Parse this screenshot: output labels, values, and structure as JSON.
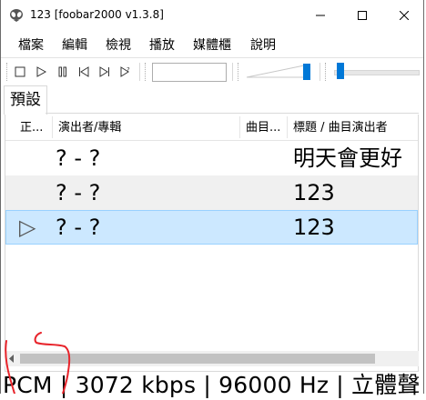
{
  "window": {
    "title": "123  [foobar2000 v1.3.8]",
    "icon": "alien-icon"
  },
  "window_controls": {
    "minimize": "minimize-icon",
    "maximize": "maximize-icon",
    "close": "close-icon"
  },
  "menu": {
    "items": [
      "檔案",
      "編輯",
      "檢視",
      "播放",
      "媒體櫃",
      "說明"
    ]
  },
  "toolbar": {
    "buttons": [
      "stop-icon",
      "play-icon",
      "pause-icon",
      "previous-icon",
      "next-icon",
      "random-icon"
    ],
    "volume_level": 1.0,
    "seek_position": 0.0
  },
  "tabs": [
    {
      "label": "預設",
      "active": true
    }
  ],
  "playlist": {
    "columns": [
      "正...",
      "演出者/專輯",
      "曲目...",
      "標題 / 曲目演出者"
    ],
    "rows": [
      {
        "playing": "",
        "artist_album": "? - ?",
        "track": "",
        "title": "明天會更好",
        "selected": false
      },
      {
        "playing": "",
        "artist_album": "? - ?",
        "track": "",
        "title": "123",
        "selected": false
      },
      {
        "playing": "▷",
        "artist_album": "? - ?",
        "track": "",
        "title": "123",
        "selected": true
      }
    ]
  },
  "status_bar": {
    "text": "PCM | 3072 kbps | 96000 Hz | 立體聲"
  },
  "colors": {
    "selection": "#cce8ff",
    "selection_border": "#99d1ff",
    "accent": "#0078d7",
    "annotation": "#e8242b"
  }
}
